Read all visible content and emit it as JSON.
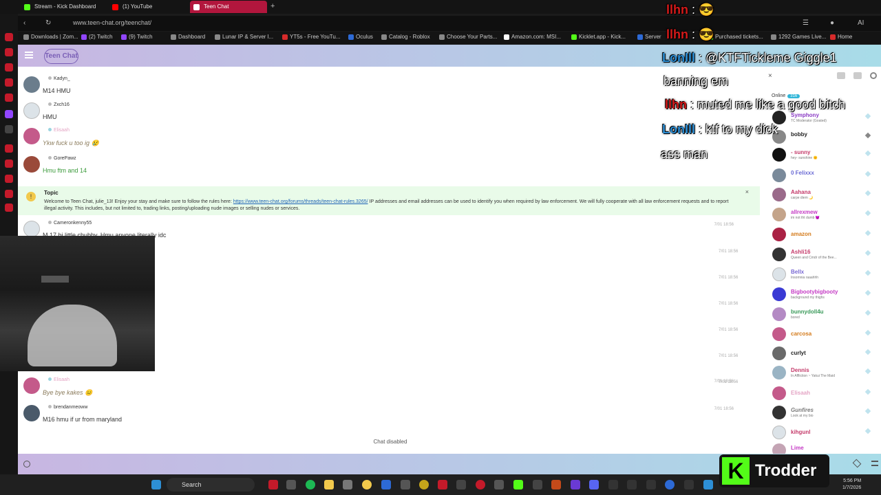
{
  "browser": {
    "tabs": [
      {
        "label": "Stream - Kick Dashboard",
        "color": "#53fc18"
      },
      {
        "label": "(1) YouTube",
        "color": "#ff0000"
      },
      {
        "label": "Teen Chat",
        "color": "#ffffff"
      }
    ],
    "new_tab": "+",
    "url": "www.teen-chat.org/teenchat/",
    "bookmarks": [
      "Downloads | Zom...",
      "(2) Twitch",
      "(9) Twitch",
      "Dashboard",
      "Lunar IP & Server l...",
      "YT5s - Free YouTu...",
      "Oculus",
      "Catalog - Roblox",
      "Choose Your Parts...",
      "Amazon.com: MSI...",
      "Kicklet.app - Kick...",
      "Server",
      "Purchased tickets...",
      "1292 Games Live...",
      "Home"
    ]
  },
  "app": {
    "logo": "Teen Chat"
  },
  "chat": {
    "messages": [
      {
        "user": "Kadyn_",
        "text": "M14 HMU",
        "time": "",
        "avatar_color": "#6b7d8c",
        "text_color": "#333333"
      },
      {
        "user": "Zxch16",
        "text": "HMU",
        "time": "",
        "avatar_color": "#dce3e8",
        "text_color": "#333333"
      },
      {
        "user": "Elisaah",
        "text": "Ykw fuck u too ig 😢",
        "time": "",
        "avatar_color": "#c45a8a",
        "text_color": "#8a7a5a"
      },
      {
        "user": "GorePawz",
        "text": "Hmu ftm and 14",
        "time": "",
        "avatar_color": "#9a4a3a",
        "text_color": "#3a9a3a"
      }
    ],
    "topic": {
      "title": "Topic",
      "text_before": "Welcome to Teen Chat, julie_13! Enjoy your stay and make sure to follow the rules here: ",
      "link": "https://www.teen-chat.org/forums/threads/teen-chat-rules.3265/",
      "text_after": " IP addresses and email addresses can be used to identify you when required by law enforcement. We will fully cooperate with all law enforcement requests and to report illegal activity. This includes, but not limited to, trading links, posting/uploading nude images or selling nudes or services.",
      "close": "×"
    },
    "late_messages": [
      {
        "user": "Cameronkenny55",
        "text": "M 17 bi little chubby. Hmu anyone literally idc",
        "time": "7/01 18:56",
        "avatar_color": "#dce3e8",
        "text_color": "#333333"
      },
      {
        "user": "Elisaah",
        "text": "Bye bye kakes 😐",
        "time": "7/01 18:56",
        "avatar_color": "#c45a8a",
        "text_color": "#8a7a5a"
      },
      {
        "user": "brendanmeoww",
        "text": "M16 hmu if ur from maryland",
        "time": "7/01 18:56",
        "avatar_color": "#4a5a6a",
        "text_color": "#333333"
      }
    ],
    "extra_times": [
      "7/01 18:56",
      "7/01 18:56",
      "7/01 18:56",
      "7/01 18:56",
      "7/01 18:56",
      "7/01 18:56"
    ],
    "disabled_notice": "Chat disabled"
  },
  "members": {
    "close": "×",
    "online_label": "Online",
    "online_count": "316",
    "list": [
      {
        "name": "Symphony",
        "status": "TC Moderator (Goated)",
        "color": "#8a3ac4",
        "avatar": "#222222"
      },
      {
        "name": "bobby",
        "status": "",
        "color": "#222222",
        "avatar": "#888888"
      },
      {
        "name": "- sunny",
        "status": "hey- sunshine 🌞",
        "color": "#c43a6a",
        "avatar": "#111111"
      },
      {
        "name": "0 Felixxx",
        "status": "",
        "color": "#6a6ad4",
        "avatar": "#7a8a9a"
      },
      {
        "name": "Aahana",
        "status": "carpe diem 🌙",
        "color": "#c43a6a",
        "avatar": "#9a6a8a"
      },
      {
        "name": "allrexmew",
        "status": "im not tht dumb 😈",
        "color": "#c43ac4",
        "avatar": "#c4a48a"
      },
      {
        "name": "amazon",
        "status": "",
        "color": "#d47a1a",
        "avatar": "#aa2244"
      },
      {
        "name": "Ashli16",
        "status": "Queen and Cmdr of the Bee...",
        "color": "#c43a6a",
        "avatar": "#333333"
      },
      {
        "name": "Bellx",
        "status": "Insomnia raaahhh",
        "color": "#7a6ad4",
        "avatar": "#dce3e8"
      },
      {
        "name": "Bigbootybigbooty",
        "status": "background my thighs",
        "color": "#c43ac4",
        "avatar": "#3a3ad4"
      },
      {
        "name": "bunnydoll4u",
        "status": "bored",
        "color": "#3a9a5a",
        "avatar": "#b48ac4"
      },
      {
        "name": "carcosa",
        "status": "",
        "color": "#d47a1a",
        "avatar": "#c45a8a"
      },
      {
        "name": "curlyt",
        "status": "",
        "color": "#222222",
        "avatar": "#6a6a6a"
      },
      {
        "name": "Dennis",
        "status": "In Affliction ~ Yakui The Maid",
        "color": "#c43a6a",
        "avatar": "#9ab4c4"
      },
      {
        "name": "Elisaah",
        "status": "",
        "color": "#e4a4c4",
        "avatar": "#c45a8a"
      },
      {
        "name": "Gunfires",
        "status": "Look at my bio",
        "color": "#7a7a7a",
        "avatar": "#333333"
      },
      {
        "name": "kihgunl",
        "status": "",
        "color": "#c43a6a",
        "avatar": "#dce3e8"
      },
      {
        "name": "Lime",
        "status": "",
        "color": "#c43ac4",
        "avatar": "#c4a4b4"
      }
    ]
  },
  "taskbar": {
    "search": "Search",
    "time": "5:56 PM",
    "date": "1/7/2026"
  },
  "stream_overlay": {
    "lines": [
      {
        "name": "llhn",
        "text": ": 😎",
        "name_color": "#d51a1a"
      },
      {
        "name": "llhn",
        "text": ": 😎",
        "name_color": "#d51a1a"
      },
      {
        "name": "LonIll",
        "text": ": @KTFTickleme Giggle1",
        "name_color": "#2d8fd6"
      },
      {
        "name": "",
        "text": "banning em",
        "name_color": ""
      },
      {
        "name": "llhn",
        "text": ": muted me like a good bitch",
        "name_color": "#d51a1a"
      },
      {
        "name": "LonIll",
        "text": ": ktf to my dick",
        "name_color": "#2d8fd6"
      },
      {
        "name": "",
        "text": "ass man",
        "name_color": ""
      }
    ],
    "logo_letter": "K",
    "streamer": "Trodder"
  }
}
